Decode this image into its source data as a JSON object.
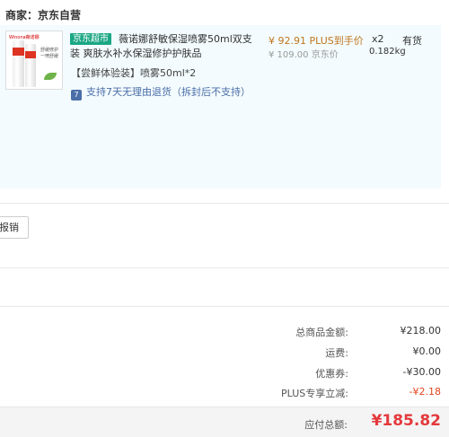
{
  "merchant": {
    "label": "商家：",
    "name": "京东自营"
  },
  "item": {
    "channel_tag": "京东超市",
    "title": "薇诺娜舒敏保湿喷雾50ml双支装 爽肤水补水保湿修护护肤品",
    "gift": "【尝鲜体验装】喷雾50ml*2",
    "service_icon": "7",
    "service_text": "支持7天无理由退货（拆封后不支持）",
    "price_plus": "¥ 92.91 PLUS到手价",
    "price_jd": "¥ 109.00 京东价",
    "qty": "x2",
    "weight": "0.182kg",
    "stock": "有货",
    "image": {
      "icon": "product-thumbnail",
      "brand_text": "Winona薇诺娜",
      "caption": "舒缓修护 一喷舒缓"
    }
  },
  "invoice": {
    "report_label": "报销"
  },
  "summary": {
    "rows": [
      {
        "label": "总商品金额:",
        "value": "¥218.00"
      },
      {
        "label": "运费:",
        "value": "¥0.00"
      },
      {
        "label": "优惠券:",
        "value": "-¥30.00"
      },
      {
        "label": "PLUS专享立减:",
        "value": "-¥2.18"
      }
    ],
    "total_label": "应付总额:",
    "total_value": "¥185.82"
  },
  "colors": {
    "accent_red": "#e4393c",
    "plus_price": "#c0761c",
    "jd_market_tag": "#1ba784",
    "order_bg": "#f3fbfe"
  }
}
